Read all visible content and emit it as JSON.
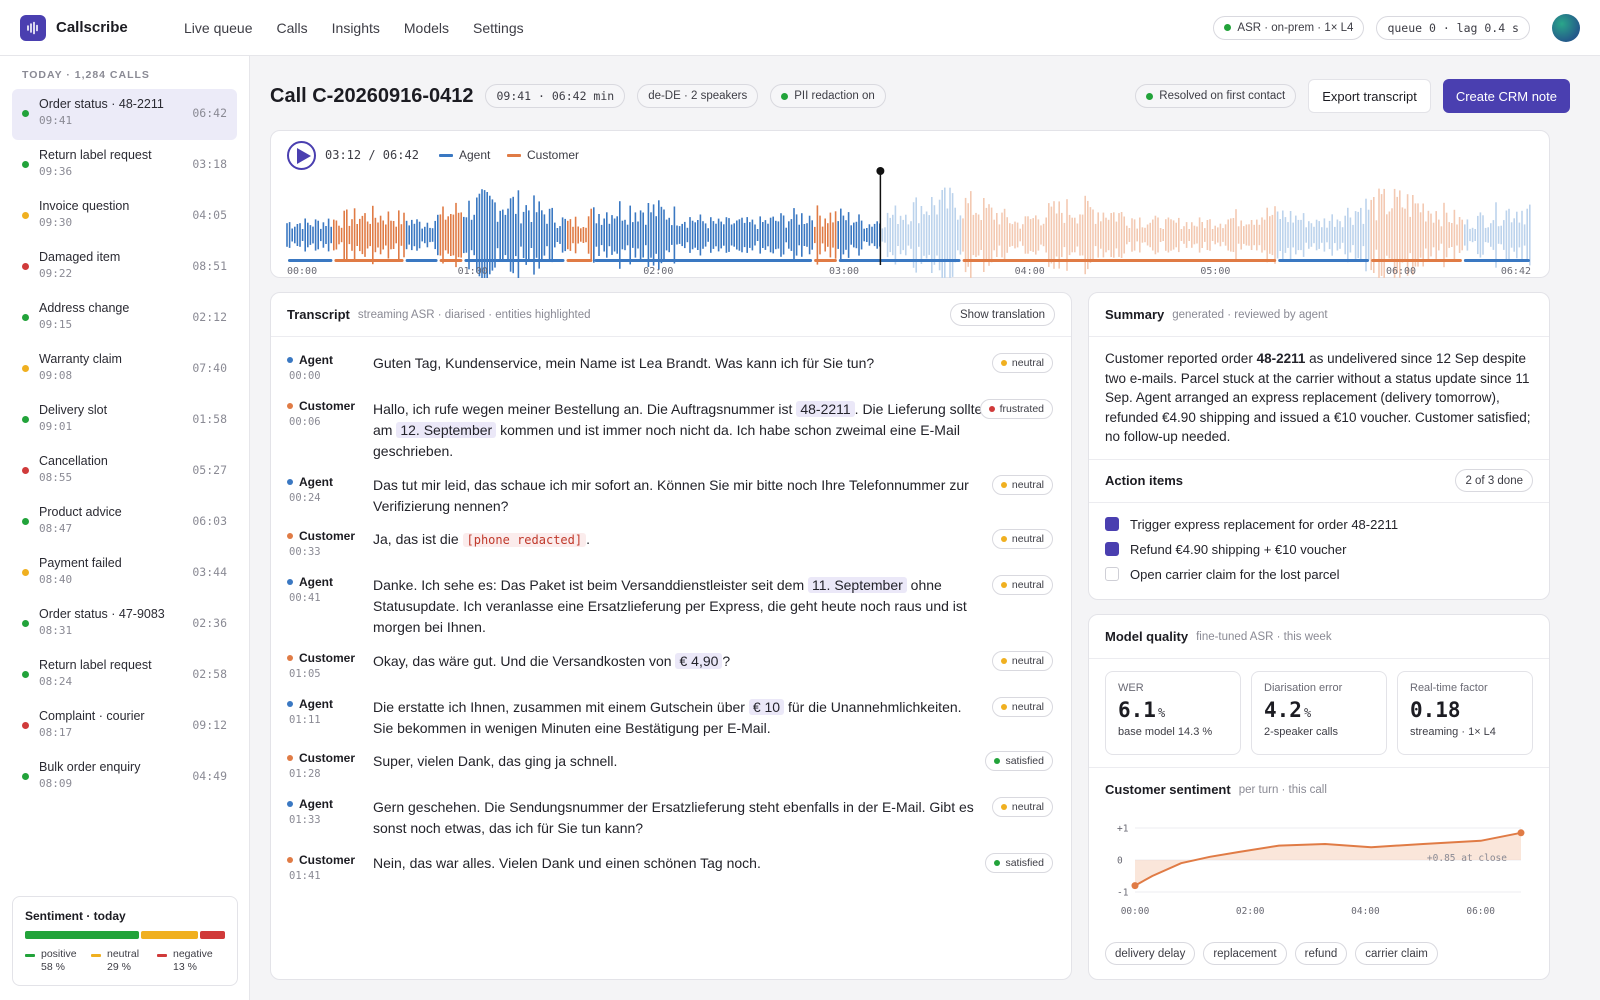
{
  "app": {
    "name": "Callscribe",
    "nav": [
      "Live queue",
      "Calls",
      "Insights",
      "Models",
      "Settings"
    ],
    "asr_status": "ASR · on-prem · 1× L4",
    "queue_status": "queue 0 · lag 0.4 s",
    "asr_status_color": "#22a33a"
  },
  "sidebar": {
    "header": "TODAY · 1,284 CALLS",
    "calls": [
      {
        "title": "Order status · 48-2211",
        "time": "09:41",
        "duration": "06:42",
        "status_color": "#22a33a",
        "active": true
      },
      {
        "title": "Return label request",
        "time": "09:36",
        "duration": "03:18",
        "status_color": "#22a33a"
      },
      {
        "title": "Invoice question",
        "time": "09:30",
        "duration": "04:05",
        "status_color": "#f0b020"
      },
      {
        "title": "Damaged item",
        "time": "09:22",
        "duration": "08:51",
        "status_color": "#d03a3a"
      },
      {
        "title": "Address change",
        "time": "09:15",
        "duration": "02:12",
        "status_color": "#22a33a"
      },
      {
        "title": "Warranty claim",
        "time": "09:08",
        "duration": "07:40",
        "status_color": "#f0b020"
      },
      {
        "title": "Delivery slot",
        "time": "09:01",
        "duration": "01:58",
        "status_color": "#22a33a"
      },
      {
        "title": "Cancellation",
        "time": "08:55",
        "duration": "05:27",
        "status_color": "#d03a3a"
      },
      {
        "title": "Product advice",
        "time": "08:47",
        "duration": "06:03",
        "status_color": "#22a33a"
      },
      {
        "title": "Payment failed",
        "time": "08:40",
        "duration": "03:44",
        "status_color": "#f0b020"
      },
      {
        "title": "Order status · 47-9083",
        "time": "08:31",
        "duration": "02:36",
        "status_color": "#22a33a"
      },
      {
        "title": "Return label request",
        "time": "08:24",
        "duration": "02:58",
        "status_color": "#22a33a"
      },
      {
        "title": "Complaint · courier",
        "time": "08:17",
        "duration": "09:12",
        "status_color": "#d03a3a"
      },
      {
        "title": "Bulk order enquiry",
        "time": "08:09",
        "duration": "04:49",
        "status_color": "#22a33a"
      }
    ],
    "sentiment": {
      "title": "Sentiment · today",
      "segments": [
        {
          "label": "positive",
          "value": "58 %",
          "pct": 58,
          "color": "#22a33a"
        },
        {
          "label": "neutral",
          "value": "29 %",
          "pct": 29,
          "color": "#f0b020"
        },
        {
          "label": "negative",
          "value": "13 %",
          "pct": 13,
          "color": "#d03a3a"
        }
      ]
    }
  },
  "call": {
    "id": "Call C-20260916-0412",
    "time_chip": "09:41 · 06:42 min",
    "lang_chip": "de-DE · 2 speakers",
    "pii_chip": "PII redaction on",
    "resolution": "Resolved on first contact",
    "export_label": "Export transcript",
    "crm_label": "Create CRM note"
  },
  "player": {
    "position": "03:12 / 06:42",
    "played_fraction": 0.477,
    "legend": [
      {
        "name": "Agent",
        "color": "#3a78c2"
      },
      {
        "name": "Customer",
        "color": "#e07b45"
      }
    ],
    "ticks": [
      "00:00",
      "01:00",
      "02:00",
      "03:00",
      "04:00",
      "05:00",
      "06:00",
      "06:42"
    ],
    "speaker_segments_sec": [
      [
        0,
        15,
        "agent"
      ],
      [
        15,
        38,
        "customer"
      ],
      [
        38,
        49,
        "agent"
      ],
      [
        49,
        57,
        "customer"
      ],
      [
        57,
        90,
        "agent"
      ],
      [
        90,
        99,
        "customer"
      ],
      [
        99,
        170,
        "agent"
      ],
      [
        170,
        178,
        "customer"
      ],
      [
        178,
        218,
        "agent"
      ],
      [
        218,
        320,
        "customer"
      ],
      [
        320,
        350,
        "agent"
      ],
      [
        350,
        380,
        "customer"
      ],
      [
        380,
        402,
        "agent"
      ]
    ]
  },
  "transcript": {
    "title": "Transcript",
    "subtitle": "streaming ASR · diarised · entities highlighted",
    "translation_label": "Show translation",
    "turns": [
      {
        "speaker": "Agent",
        "time": "00:00",
        "sentiment": "neutral",
        "parts": [
          {
            "t": "Guten Tag, Kundenservice, mein Name ist Lea Brandt. Was kann ich für Sie tun?"
          }
        ]
      },
      {
        "speaker": "Customer",
        "time": "00:06",
        "sentiment": "frustrated",
        "parts": [
          {
            "t": "Hallo, ich rufe wegen meiner Bestellung an. Die Auftragsnummer ist "
          },
          {
            "e": "48-2211"
          },
          {
            "t": ". Die Lieferung sollte am "
          },
          {
            "e": "12. September"
          },
          {
            "t": " kommen und ist immer noch nicht da. Ich habe schon zweimal eine E-Mail geschrieben."
          }
        ]
      },
      {
        "speaker": "Agent",
        "time": "00:24",
        "sentiment": "neutral",
        "parts": [
          {
            "t": "Das tut mir leid, das schaue ich mir sofort an. Können Sie mir bitte noch Ihre Telefonnummer zur Verifizierung nennen?"
          }
        ]
      },
      {
        "speaker": "Customer",
        "time": "00:33",
        "sentiment": "neutral",
        "parts": [
          {
            "t": "Ja, das ist die "
          },
          {
            "r": "[phone redacted]"
          },
          {
            "t": "."
          }
        ]
      },
      {
        "speaker": "Agent",
        "time": "00:41",
        "sentiment": "neutral",
        "parts": [
          {
            "t": "Danke. Ich sehe es: Das Paket ist beim Versanddienstleister seit dem "
          },
          {
            "e": "11. September"
          },
          {
            "t": " ohne Statusupdate. Ich veranlasse eine Ersatzlieferung per Express, die geht heute noch raus und ist morgen bei Ihnen."
          }
        ]
      },
      {
        "speaker": "Customer",
        "time": "01:05",
        "sentiment": "neutral",
        "parts": [
          {
            "t": "Okay, das wäre gut. Und die Versandkosten von "
          },
          {
            "e": "€ 4,90"
          },
          {
            "t": "?"
          }
        ]
      },
      {
        "speaker": "Agent",
        "time": "01:11",
        "sentiment": "neutral",
        "parts": [
          {
            "t": "Die erstatte ich Ihnen, zusammen mit einem Gutschein über "
          },
          {
            "e": "€ 10"
          },
          {
            "t": " für die Unannehmlichkeiten. Sie bekommen in wenigen Minuten eine Bestätigung per E-Mail."
          }
        ]
      },
      {
        "speaker": "Customer",
        "time": "01:28",
        "sentiment": "satisfied",
        "parts": [
          {
            "t": "Super, vielen Dank, das ging ja schnell."
          }
        ]
      },
      {
        "speaker": "Agent",
        "time": "01:33",
        "sentiment": "neutral",
        "parts": [
          {
            "t": "Gern geschehen. Die Sendungsnummer der Ersatzlieferung steht ebenfalls in der E-Mail. Gibt es sonst noch etwas, das ich für Sie tun kann?"
          }
        ]
      },
      {
        "speaker": "Customer",
        "time": "01:41",
        "sentiment": "satisfied",
        "parts": [
          {
            "t": "Nein, das war alles. Vielen Dank und einen schönen Tag noch."
          }
        ]
      }
    ],
    "sentiment_colors": {
      "neutral": "#f0b020",
      "frustrated": "#d03a3a",
      "satisfied": "#22a33a"
    },
    "speaker_colors": {
      "Agent": "#3a78c2",
      "Customer": "#e07b45"
    }
  },
  "summary": {
    "title": "Summary",
    "subtitle": "generated · reviewed by agent",
    "parts": [
      {
        "t": "Customer reported order "
      },
      {
        "b": "48-2211"
      },
      {
        "t": " as undelivered since 12 Sep despite two e-mails. Parcel stuck at the carrier without a status update since 11 Sep. Agent arranged an express replacement (delivery tomorrow), refunded €4.90 shipping and issued a €10 voucher. Customer satisfied; no follow-up needed."
      }
    ]
  },
  "actions": {
    "title": "Action items",
    "progress": "2 of 3 done",
    "items": [
      {
        "label": "Trigger express replacement for order 48-2211",
        "done": true
      },
      {
        "label": "Refund €4.90 shipping + €10 voucher",
        "done": true
      },
      {
        "label": "Open carrier claim for the lost parcel",
        "done": false
      }
    ]
  },
  "model_quality": {
    "title": "Model quality",
    "subtitle": "fine-tuned ASR · this week",
    "metrics": [
      {
        "label": "WER",
        "value": "6.1",
        "unit": "%",
        "sub": "base model 14.3 %"
      },
      {
        "label": "Diarisation error",
        "value": "4.2",
        "unit": "%",
        "sub": "2-speaker calls"
      },
      {
        "label": "Real-time factor",
        "value": "0.18",
        "unit": "",
        "sub": "streaming · 1× L4"
      }
    ]
  },
  "sentiment_chart": {
    "title": "Customer sentiment",
    "subtitle": "per turn · this call",
    "annotation": "+0.85 at close",
    "keywords": [
      "delivery delay",
      "replacement",
      "refund",
      "carrier claim"
    ]
  },
  "chart_data": {
    "type": "area",
    "title": "Customer sentiment",
    "ylim": [
      -1,
      1
    ],
    "y_ticks": [
      "+1",
      "0",
      "-1"
    ],
    "x_ticks": [
      "00:00",
      "02:00",
      "04:00",
      "06:00"
    ],
    "x_range_min": [
      0,
      6.7
    ],
    "points": [
      [
        0,
        -0.8
      ],
      [
        0.3,
        -0.5
      ],
      [
        0.8,
        -0.1
      ],
      [
        1.3,
        0.1
      ],
      [
        1.8,
        0.25
      ],
      [
        2.5,
        0.45
      ],
      [
        3.3,
        0.5
      ],
      [
        4.1,
        0.4
      ],
      [
        5.0,
        0.5
      ],
      [
        6.0,
        0.6
      ],
      [
        6.7,
        0.85
      ]
    ]
  }
}
